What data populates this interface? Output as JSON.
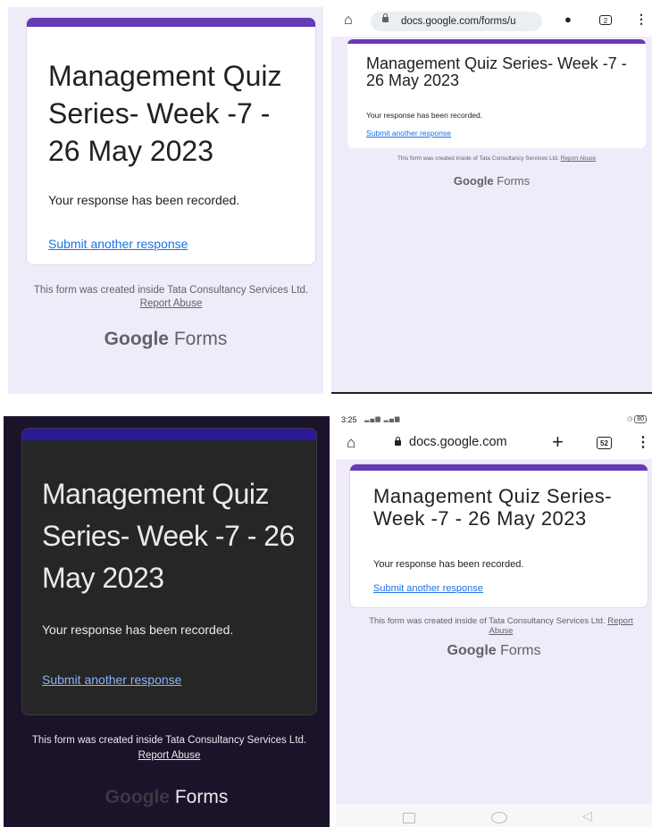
{
  "form": {
    "title": "Management Quiz Series- Week -7 - 26 May 2023",
    "response_message": "Your response has been recorded.",
    "submit_another": "Submit another response"
  },
  "panel_desktop": {
    "footer_text": "This form was created inside Tata Consultancy Services Ltd.",
    "report_abuse": "Report Abuse",
    "brand_google": "Google",
    "brand_forms": "Forms",
    "accent_color": "#673ab7"
  },
  "panel_mobile_small": {
    "url": "docs.google.com/forms/u",
    "tab_count": "2",
    "footer_text": "This form was created inside of Tata Consultancy Services Ltd.",
    "report_abuse": "Report Abuse",
    "brand_google": "Google",
    "brand_forms": "Forms"
  },
  "panel_dark": {
    "footer_text": "This form was created inside Tata Consultancy Services Ltd.",
    "report_abuse": "Report Abuse",
    "brand_google": "Google",
    "brand_forms": "Forms",
    "accent_color": "#2a1a99"
  },
  "panel_mobile_large": {
    "status_time": "3:25",
    "battery": "80",
    "url": "docs.google.com",
    "tab_count": "52",
    "footer_text": "This form was created inside of Tata Consultancy Services Ltd.",
    "report_abuse": "Report Abuse",
    "brand_google": "Google",
    "brand_forms": "Forms"
  }
}
